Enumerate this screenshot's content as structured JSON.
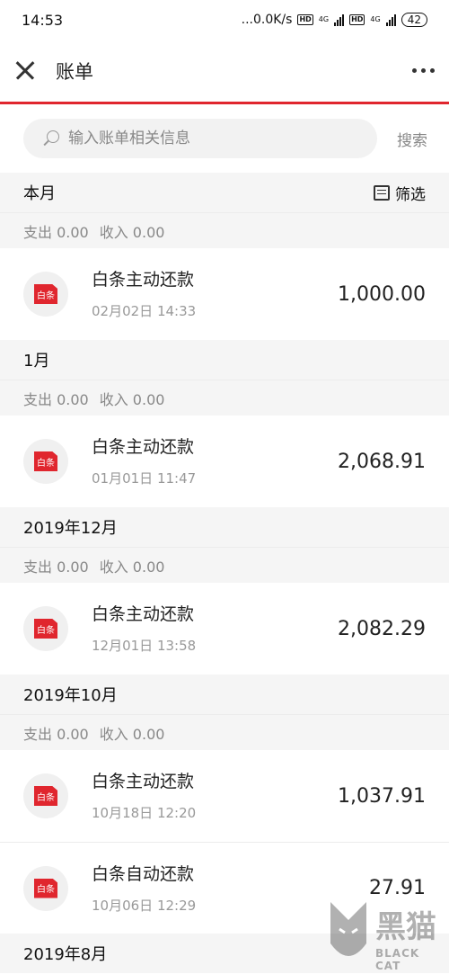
{
  "status_bar": {
    "time": "14:53",
    "net_speed": "...0.0K/s",
    "hd": "HD",
    "network": "4G",
    "battery": "42"
  },
  "nav": {
    "title": "账单",
    "close_icon": "close-icon",
    "more_icon": "more-icon"
  },
  "search": {
    "placeholder": "输入账单相关信息",
    "button": "搜索"
  },
  "filter_label": "筛选",
  "groups": [
    {
      "month": "本月",
      "expense": "支出 0.00",
      "income": "收入 0.00",
      "transactions": [
        {
          "logo": "白条",
          "title": "白条主动还款",
          "time": "02月02日 14:33",
          "amount": "1,000.00"
        }
      ]
    },
    {
      "month": "1月",
      "expense": "支出 0.00",
      "income": "收入 0.00",
      "transactions": [
        {
          "logo": "白条",
          "title": "白条主动还款",
          "time": "01月01日 11:47",
          "amount": "2,068.91"
        }
      ]
    },
    {
      "month": "2019年12月",
      "expense": "支出 0.00",
      "income": "收入 0.00",
      "transactions": [
        {
          "logo": "白条",
          "title": "白条主动还款",
          "time": "12月01日 13:58",
          "amount": "2,082.29"
        }
      ]
    },
    {
      "month": "2019年10月",
      "expense": "支出 0.00",
      "income": "收入 0.00",
      "transactions": [
        {
          "logo": "白条",
          "title": "白条主动还款",
          "time": "10月18日 12:20",
          "amount": "1,037.91"
        },
        {
          "logo": "白条",
          "title": "白条自动还款",
          "time": "10月06日 12:29",
          "amount": "27.91"
        }
      ]
    },
    {
      "month": "2019年8月",
      "transactions": []
    }
  ],
  "watermark": {
    "cn": "黑猫",
    "en": "BLACK CAT"
  },
  "colors": {
    "accent": "#e0262e",
    "section_bg": "#f5f5f5",
    "muted_text": "#888888"
  }
}
